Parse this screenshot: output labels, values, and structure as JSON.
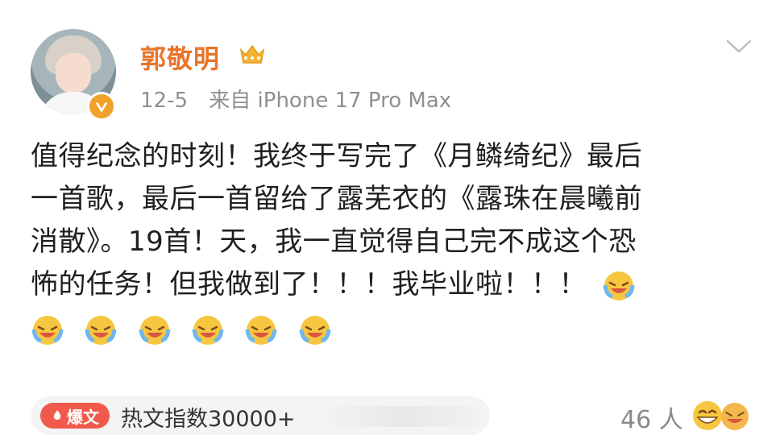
{
  "post": {
    "username": "郭敬明",
    "date": "12-5",
    "source": "来自 iPhone 17 Pro Max",
    "lines": [
      "值得纪念的时刻！我终于写完了《月鳞绮纪》最后",
      "一首歌，最后一首留给了露芜衣的《露珠在晨曦前",
      "消散》。19首！天，我一直觉得自己完不成这个恐",
      "怖的任务！但我做到了！！！我毕业啦！！！"
    ]
  },
  "hot": {
    "badge": "爆文",
    "label": "热文指数30000+"
  },
  "reactions": {
    "count": "46 人"
  },
  "colors": {
    "username": "#e8752a",
    "badge": "#f15a4a",
    "verified": "#f0a22a"
  },
  "icons": {
    "crown": "crown-icon",
    "verified": "verified-icon",
    "chevron": "chevron-down-icon",
    "emoji": "crying-laughing-emoji",
    "reaction": "laughing-emoji"
  }
}
